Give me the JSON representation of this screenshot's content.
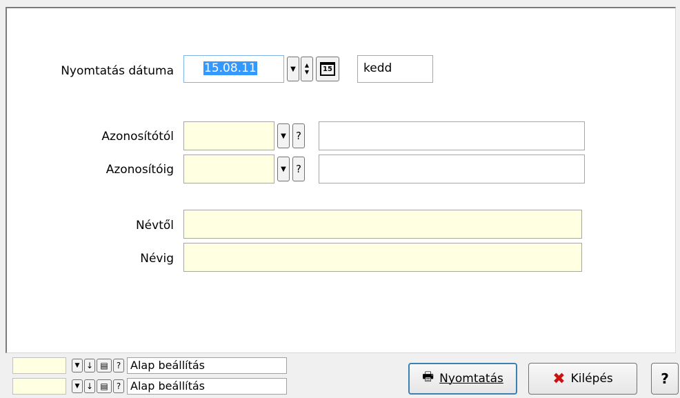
{
  "form": {
    "date_label": "Nyomtatás dátuma",
    "date_value": "15.08.11",
    "calendar_day": "15",
    "weekday": "kedd",
    "from_id_label": "Azonosítótól",
    "to_id_label": "Azonosítóig",
    "from_name_label": "Névtől",
    "to_name_label": "Névig",
    "help_glyph": "?"
  },
  "bottom": {
    "preset1": "Alap beállítás",
    "preset2": "Alap beállítás"
  },
  "buttons": {
    "print": "Nyomtatás",
    "exit": "Kilépés",
    "help": "?"
  },
  "colors": {
    "input_yellow": "#ffffe1",
    "selection_blue": "#3399ff",
    "exit_icon_red": "#cc1111"
  }
}
